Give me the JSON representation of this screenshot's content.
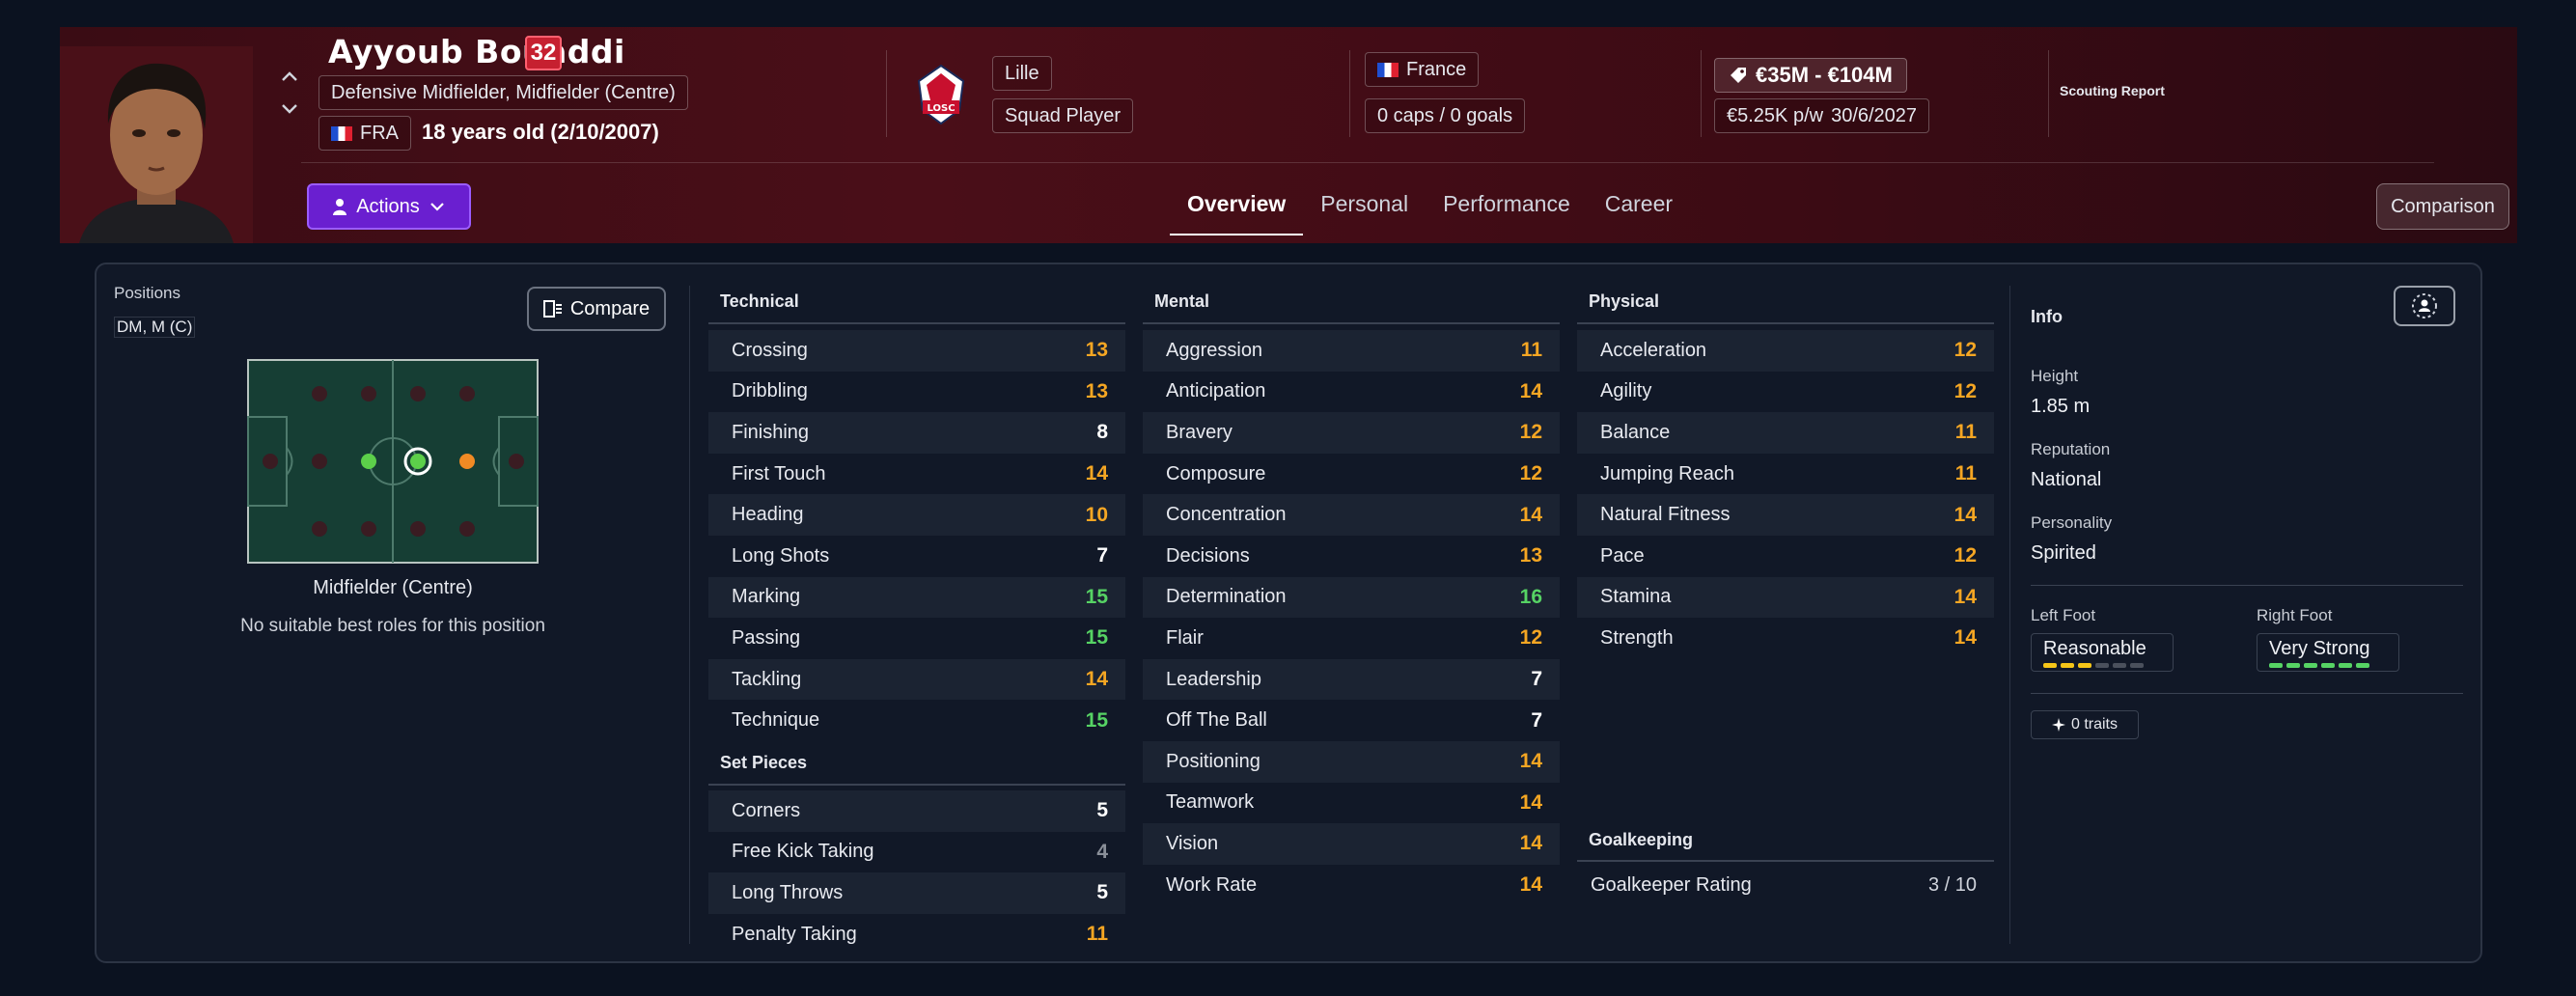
{
  "player": {
    "name": "Ayyoub Bouaddi",
    "number": "32",
    "positions_text": "Defensive Midfielder, Midfielder (Centre)",
    "nationality_code": "FRA",
    "age_text": "18 years old (2/10/2007)"
  },
  "club": {
    "name": "Lille",
    "logo_text": "LOSC",
    "squad_status": "Squad Player"
  },
  "nation": {
    "name": "France",
    "caps_text": "0 caps / 0 goals"
  },
  "contract": {
    "value_range": "€35M - €104M",
    "wage": "€5.25K p/w",
    "expiry": "30/6/2027"
  },
  "scouting_report_label": "Scouting Report",
  "actions_label": "Actions",
  "tabs": [
    {
      "label": "Overview",
      "active": true
    },
    {
      "label": "Personal",
      "active": false
    },
    {
      "label": "Performance",
      "active": false
    },
    {
      "label": "Career",
      "active": false
    }
  ],
  "comparison_label": "Comparison",
  "positions_panel": {
    "title": "Positions",
    "value": "DM, M (C)",
    "compare_label": "Compare",
    "selected_position": "Midfielder (Centre)",
    "roles_text": "No suitable best roles for this position"
  },
  "colors": {
    "good": "#56d364",
    "medium": "#f5a623",
    "normal": "#ffffff",
    "poor": "#8a8f99",
    "accent": "#6a1fd0"
  },
  "technical": {
    "title": "Technical",
    "attrs": [
      {
        "name": "Crossing",
        "value": "13",
        "tone": "orange"
      },
      {
        "name": "Dribbling",
        "value": "13",
        "tone": "orange"
      },
      {
        "name": "Finishing",
        "value": "8",
        "tone": "white"
      },
      {
        "name": "First Touch",
        "value": "14",
        "tone": "orange"
      },
      {
        "name": "Heading",
        "value": "10",
        "tone": "orange"
      },
      {
        "name": "Long Shots",
        "value": "7",
        "tone": "white"
      },
      {
        "name": "Marking",
        "value": "15",
        "tone": "green"
      },
      {
        "name": "Passing",
        "value": "15",
        "tone": "green"
      },
      {
        "name": "Tackling",
        "value": "14",
        "tone": "orange"
      },
      {
        "name": "Technique",
        "value": "15",
        "tone": "green"
      }
    ]
  },
  "set_pieces": {
    "title": "Set Pieces",
    "attrs": [
      {
        "name": "Corners",
        "value": "5",
        "tone": "white"
      },
      {
        "name": "Free Kick Taking",
        "value": "4",
        "tone": "grey"
      },
      {
        "name": "Long Throws",
        "value": "5",
        "tone": "white"
      },
      {
        "name": "Penalty Taking",
        "value": "11",
        "tone": "orange"
      }
    ]
  },
  "mental": {
    "title": "Mental",
    "attrs": [
      {
        "name": "Aggression",
        "value": "11",
        "tone": "orange"
      },
      {
        "name": "Anticipation",
        "value": "14",
        "tone": "orange"
      },
      {
        "name": "Bravery",
        "value": "12",
        "tone": "orange"
      },
      {
        "name": "Composure",
        "value": "12",
        "tone": "orange"
      },
      {
        "name": "Concentration",
        "value": "14",
        "tone": "orange"
      },
      {
        "name": "Decisions",
        "value": "13",
        "tone": "orange"
      },
      {
        "name": "Determination",
        "value": "16",
        "tone": "green"
      },
      {
        "name": "Flair",
        "value": "12",
        "tone": "orange"
      },
      {
        "name": "Leadership",
        "value": "7",
        "tone": "white"
      },
      {
        "name": "Off The Ball",
        "value": "7",
        "tone": "white"
      },
      {
        "name": "Positioning",
        "value": "14",
        "tone": "orange"
      },
      {
        "name": "Teamwork",
        "value": "14",
        "tone": "orange"
      },
      {
        "name": "Vision",
        "value": "14",
        "tone": "orange"
      },
      {
        "name": "Work Rate",
        "value": "14",
        "tone": "orange"
      }
    ]
  },
  "physical": {
    "title": "Physical",
    "attrs": [
      {
        "name": "Acceleration",
        "value": "12",
        "tone": "orange"
      },
      {
        "name": "Agility",
        "value": "12",
        "tone": "orange"
      },
      {
        "name": "Balance",
        "value": "11",
        "tone": "orange"
      },
      {
        "name": "Jumping Reach",
        "value": "11",
        "tone": "orange"
      },
      {
        "name": "Natural Fitness",
        "value": "14",
        "tone": "orange"
      },
      {
        "name": "Pace",
        "value": "12",
        "tone": "orange"
      },
      {
        "name": "Stamina",
        "value": "14",
        "tone": "orange"
      },
      {
        "name": "Strength",
        "value": "14",
        "tone": "orange"
      }
    ]
  },
  "goalkeeping": {
    "title": "Goalkeeping",
    "rating_label": "Goalkeeper Rating",
    "rating_value": "3 / 10"
  },
  "info": {
    "title": "Info",
    "height_label": "Height",
    "height_value": "1.85 m",
    "reputation_label": "Reputation",
    "reputation_value": "National",
    "personality_label": "Personality",
    "personality_value": "Spirited",
    "left_foot_label": "Left Foot",
    "left_foot_value": "Reasonable",
    "left_foot_level": 3,
    "right_foot_label": "Right Foot",
    "right_foot_value": "Very Strong",
    "right_foot_level": 6,
    "traits_label": "0 traits"
  }
}
